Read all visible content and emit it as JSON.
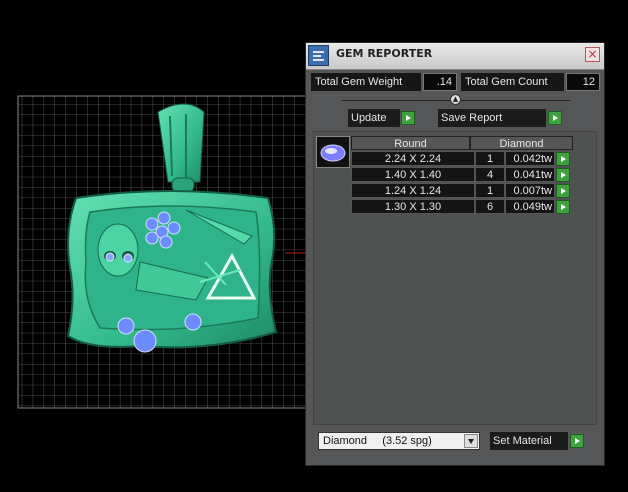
{
  "panel": {
    "title": "GEM REPORTER",
    "close_glyph": "×",
    "app_icon": "gem-reporter-icon",
    "total_gem_weight_label": "Total Gem Weight",
    "total_gem_weight_value": ".14",
    "total_gem_count_label": "Total Gem Count",
    "total_gem_count_value": "12",
    "update_label": "Update",
    "save_report_label": "Save Report",
    "table": {
      "col_shape": "Round",
      "col_material": "Diamond",
      "rows": [
        {
          "size": "2.24 X 2.24",
          "count": "1",
          "weight": "0.042tw"
        },
        {
          "size": "1.40 X 1.40",
          "count": "4",
          "weight": "0.041tw"
        },
        {
          "size": "1.24 X 1.24",
          "count": "1",
          "weight": "0.007tw"
        },
        {
          "size": "1.30 X 1.30",
          "count": "6",
          "weight": "0.049tw"
        }
      ]
    },
    "material_select": "Diamond     (3.52 spg)",
    "set_material_label": "Set Material"
  },
  "colors": {
    "pendant": "#3ec79a",
    "grid": "#9a9a9a",
    "panel_bg": "#555657",
    "action_green": "#3ea33e"
  }
}
